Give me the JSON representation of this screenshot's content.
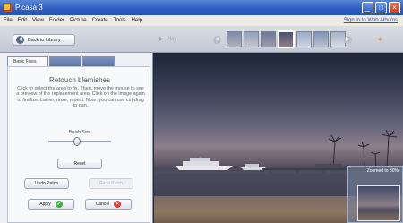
{
  "window": {
    "title": "Picasa 3"
  },
  "menu": {
    "items": [
      "File",
      "Edit",
      "View",
      "Folder",
      "Picture",
      "Create",
      "Tools",
      "Help"
    ],
    "signin": "Sign in to Web Albums"
  },
  "toolbar": {
    "back_label": "Back to Library",
    "play_label": "Play"
  },
  "panel": {
    "tabs": [
      "Basic Fixes",
      "",
      ""
    ],
    "heading": "Retouch blemishes",
    "description": "Click to select the area to fix. Then, move the mouse to see a preview of the replacement area. Click on the image again to finalize. Lather, rinse, repeat. Note: you can use ctrl-drag to pan.",
    "brush_label": "Brush Size",
    "brush_size": 0.45,
    "reset_label": "Reset",
    "undo_label": "Undo Patch",
    "redo_label": "Redo Patch",
    "apply_label": "Apply",
    "cancel_label": "Cancel"
  },
  "zoom": {
    "label": "Zoomed to 30%"
  }
}
